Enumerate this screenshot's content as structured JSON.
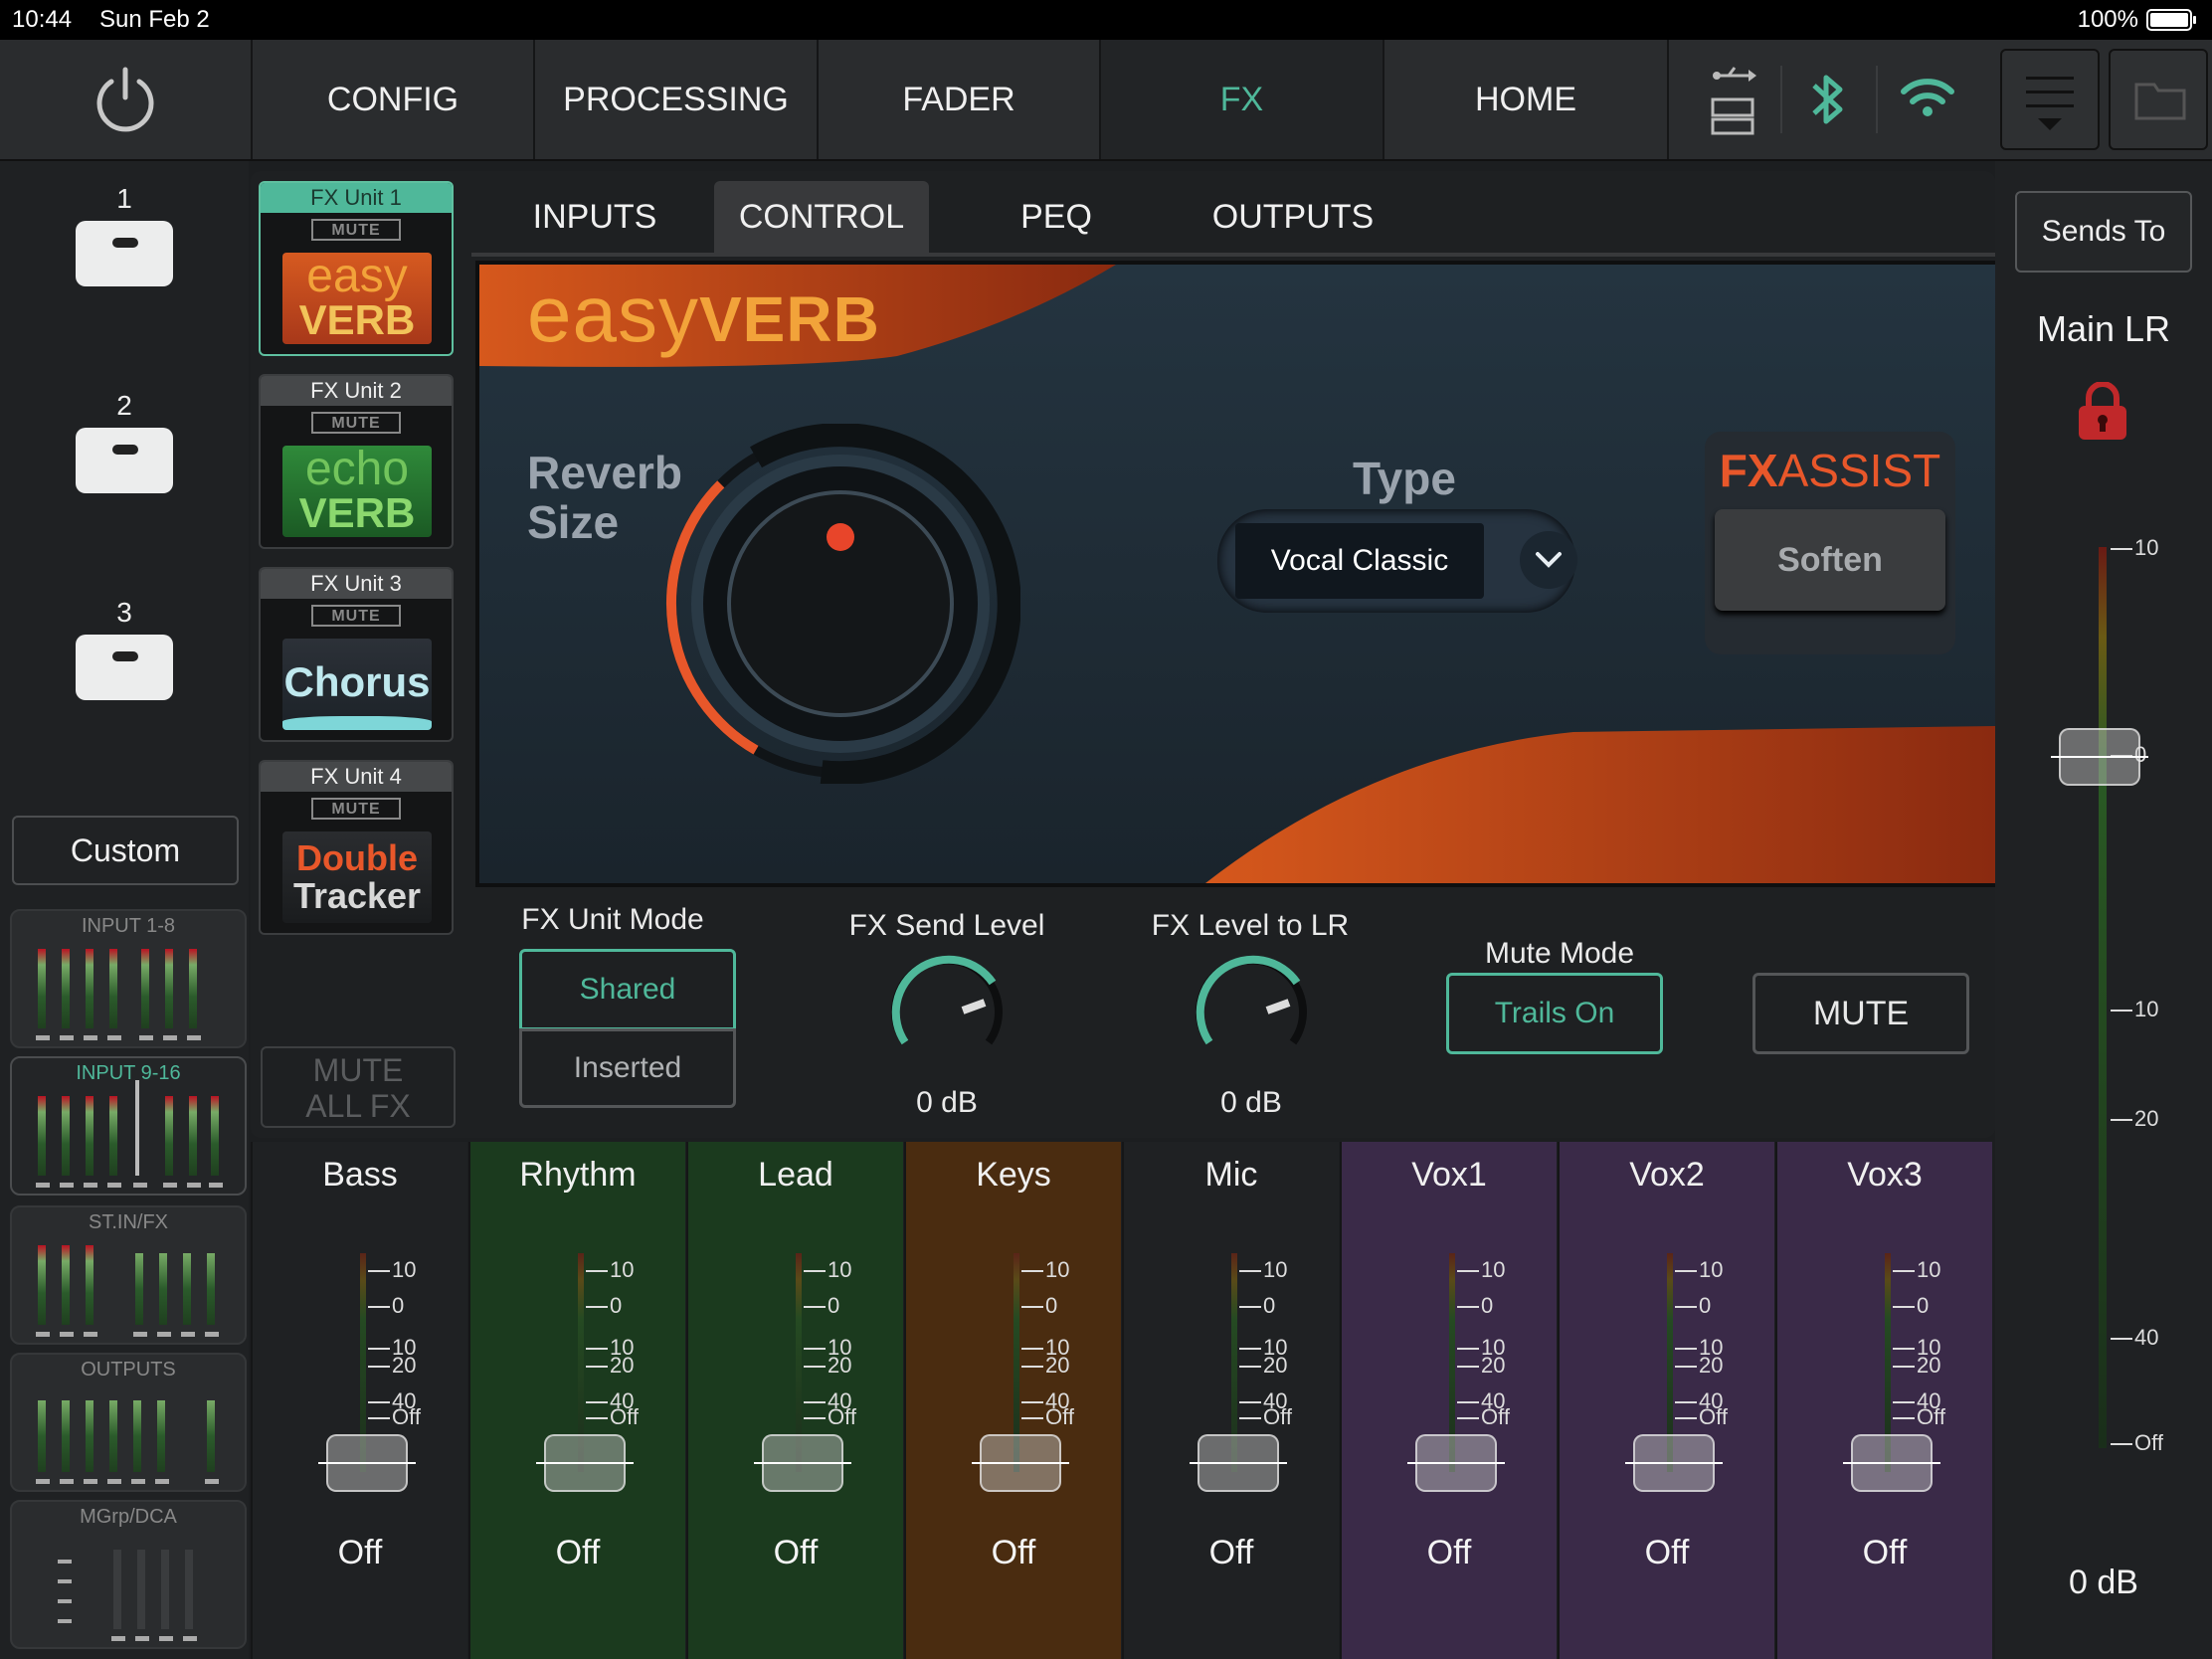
{
  "status": {
    "time": "10:44",
    "date": "Sun Feb 2",
    "battery": "100%"
  },
  "nav": {
    "tabs": [
      "CONFIG",
      "PROCESSING",
      "FADER",
      "FX",
      "HOME"
    ],
    "active": "FX"
  },
  "scenes": {
    "items": [
      "1",
      "2",
      "3"
    ],
    "custom_label": "Custom"
  },
  "banks": [
    "INPUT 1-8",
    "INPUT 9-16",
    "ST.IN/FX",
    "OUTPUTS",
    "MGrp/DCA"
  ],
  "fx_units": [
    {
      "title": "FX Unit 1",
      "mute": "MUTE",
      "logo_a": "easy",
      "logo_b": "VERB"
    },
    {
      "title": "FX Unit 2",
      "mute": "MUTE",
      "logo_a": "echo",
      "logo_b": "VERB"
    },
    {
      "title": "FX Unit 3",
      "mute": "MUTE",
      "logo_a": "Chorus",
      "logo_b": ""
    },
    {
      "title": "FX Unit 4",
      "mute": "MUTE",
      "logo_a": "Double",
      "logo_b": "Tracker"
    }
  ],
  "mute_all_fx": "MUTE\nALL FX",
  "subtabs": [
    "INPUTS",
    "CONTROL",
    "PEQ",
    "OUTPUTS"
  ],
  "plugin": {
    "brand_a": "easy",
    "brand_b": "VERB",
    "reverb_size_label": "Reverb\nSize",
    "type_label": "Type",
    "type_value": "Vocal Classic",
    "fxassist_a": "FX",
    "fxassist_b": "ASSIST",
    "fxassist_button": "Soften",
    "reverb_size_level": 0.35
  },
  "controls": {
    "unit_mode_label": "FX Unit Mode",
    "unit_mode_options": [
      "Shared",
      "Inserted"
    ],
    "unit_mode_selected": "Shared",
    "send_level_label": "FX Send Level",
    "send_level_value": "0 dB",
    "level_to_lr_label": "FX Level to LR",
    "level_to_lr_value": "0 dB",
    "mute_mode_label": "Mute Mode",
    "mute_mode_value": "Trails On",
    "mute_label": "MUTE"
  },
  "right": {
    "sends_to": "Sends To",
    "bus": "Main LR",
    "value": "0 dB",
    "scale": [
      "10",
      "0",
      "10",
      "20",
      "40",
      "Off"
    ]
  },
  "channels": [
    {
      "name": "Bass",
      "value": "Off",
      "color": "#1f2123"
    },
    {
      "name": "Rhythm",
      "value": "Off",
      "color": "#1b3a1e"
    },
    {
      "name": "Lead",
      "value": "Off",
      "color": "#1b3a1e"
    },
    {
      "name": "Keys",
      "value": "Off",
      "color": "#4a2c10"
    },
    {
      "name": "Mic",
      "value": "Off",
      "color": "#1f2123"
    },
    {
      "name": "Vox1",
      "value": "Off",
      "color": "#3a2a48"
    },
    {
      "name": "Vox2",
      "value": "Off",
      "color": "#3a2a48"
    },
    {
      "name": "Vox3",
      "value": "Off",
      "color": "#3a2a48"
    }
  ],
  "strip_scale": [
    "10",
    "0",
    "10",
    "20",
    "40",
    "Off"
  ],
  "colors": {
    "accent": "#4fb89a",
    "orange": "#e8572a",
    "brand_gold": "#f2a33a",
    "lock": "#c0282a"
  },
  "icons": [
    "power-icon",
    "usb-icon",
    "sd-card-icon",
    "bluetooth-icon",
    "wifi-icon",
    "menu-icon",
    "folder-icon",
    "lock-icon",
    "chevron-down-icon"
  ]
}
